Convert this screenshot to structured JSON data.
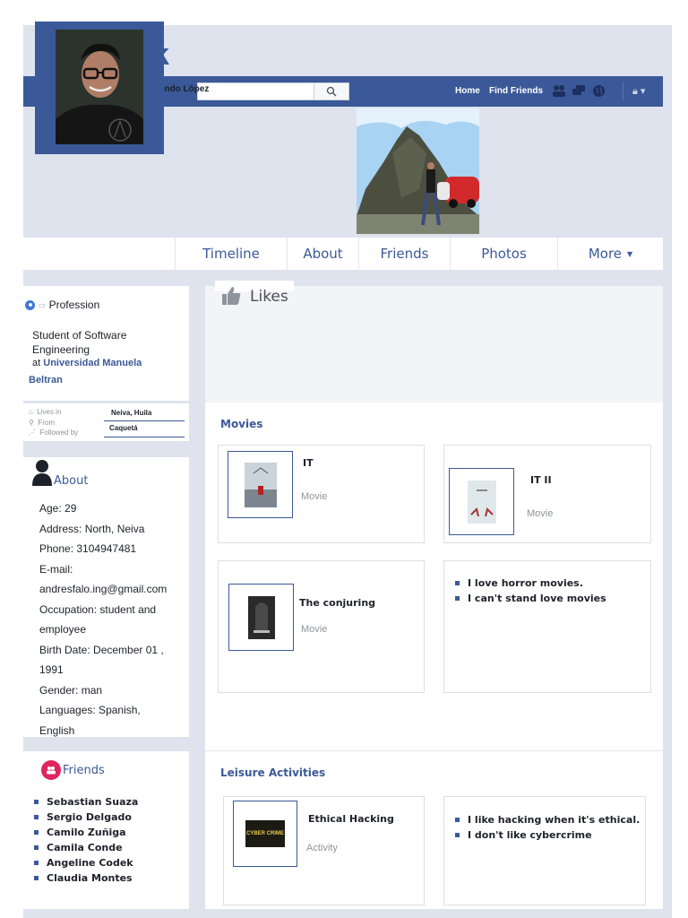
{
  "header": {
    "profile_name": "Facundo López",
    "nav_home": "Home",
    "nav_find_friends": "Find Friends",
    "icons": [
      "friends-icon",
      "messages-icon",
      "globe-icon",
      "lock-icon"
    ]
  },
  "tabs": [
    "Timeline",
    "About",
    "Friends",
    "Photos",
    "More"
  ],
  "tab_more_caret": "▼",
  "intro": {
    "profession_label": "Profession",
    "profession_text_line1": "Student of Software",
    "profession_text_line2": "Engineering",
    "profession_at": "at",
    "university": "Universidad Manuela",
    "university_line2": "Beltran",
    "lives_in_label": "Lives in",
    "from_label": "From",
    "followed_by_label": "Followed by",
    "lives_in_value": "Neiva, Huila",
    "from_value": "Caquetá"
  },
  "about": {
    "title": "About",
    "lines": [
      "Age: 29",
      "Address: North, Neiva",
      "Phone: 3104947481",
      "E-mail:",
      "andresfalo.ing@gmail.com",
      "Occupation: student and",
      "employee",
      "Birth Date: December 01 ,",
      "1991",
      "Gender: man",
      "Languages: Spanish,",
      "English"
    ]
  },
  "friends": {
    "title": "Friends",
    "list": [
      "Sebastian Suaza",
      "Sergio Delgado",
      "Camilo Zuñiga",
      "Camila Conde",
      "Angeline Codek",
      "Claudia Montes"
    ]
  },
  "likes": {
    "title": "Likes",
    "movies_title": "Movies",
    "movies": [
      {
        "title": "IT",
        "type": "Movie"
      },
      {
        "title": "IT II",
        "type": "Movie"
      },
      {
        "title": "The conjuring",
        "type": "Movie"
      }
    ],
    "movie_notes": [
      "I love horror movies.",
      "I can't stand love movies"
    ],
    "leisure_title": "Leisure Activities",
    "activity": {
      "title": "Ethical Hacking",
      "type": "Activity",
      "thumb_text": "CYBER CRIME"
    },
    "activity_notes": [
      "I like hacking when it's ethical.",
      "I don't like cybercrime"
    ]
  }
}
